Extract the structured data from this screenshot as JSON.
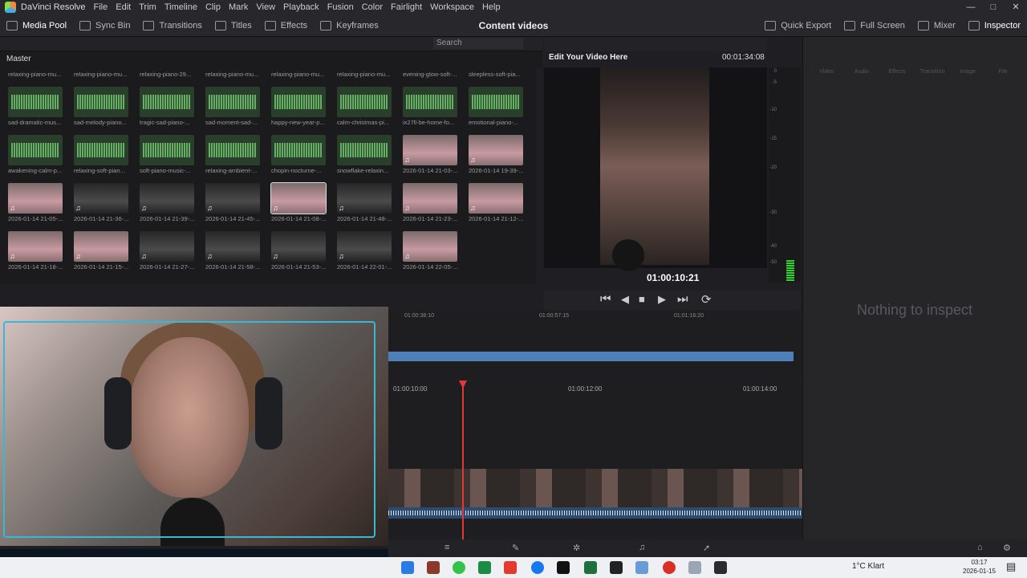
{
  "menubar": {
    "app_name": "DaVinci Resolve",
    "items": [
      "File",
      "Edit",
      "Trim",
      "Timeline",
      "Clip",
      "Mark",
      "View",
      "Playback",
      "Fusion",
      "Color",
      "Fairlight",
      "Workspace",
      "Help"
    ]
  },
  "toolbar": {
    "media_pool": "Media Pool",
    "sync_bin": "Sync Bin",
    "transitions": "Transitions",
    "titles": "Titles",
    "effects": "Effects",
    "keyframes": "Keyframes",
    "project_title": "Content videos",
    "quick_export": "Quick Export",
    "full_screen": "Full Screen",
    "mixer": "Mixer",
    "inspector": "Inspector"
  },
  "media_pool": {
    "search_placeholder": "Search",
    "bin_name": "Master",
    "top_labels": [
      "relaxing-piano-mu...",
      "relaxing-piano-mu...",
      "relaxing-piano-29...",
      "relaxing-piano-mu...",
      "relaxing-piano-mu...",
      "relaxing-piano-mu...",
      "evening-glow-soft-...",
      "sleepless-soft-pia..."
    ],
    "rows": [
      [
        {
          "label": "sad-dramatic-mus...",
          "kind": "audio"
        },
        {
          "label": "sad-melody-piano...",
          "kind": "audio"
        },
        {
          "label": "tragic-sad-piano-...",
          "kind": "audio"
        },
        {
          "label": "sad-moment-sad-...",
          "kind": "audio"
        },
        {
          "label": "happy-new-year-p...",
          "kind": "audio"
        },
        {
          "label": "calm-christmas-pi...",
          "kind": "audio"
        },
        {
          "label": "ix27ll-be-home-fo...",
          "kind": "audio"
        },
        {
          "label": "emotional-piano-...",
          "kind": "audio"
        }
      ],
      [
        {
          "label": "awakening-calm-p...",
          "kind": "audio"
        },
        {
          "label": "relaxing-soft-pian...",
          "kind": "audio"
        },
        {
          "label": "soft-piano-music-...",
          "kind": "audio"
        },
        {
          "label": "relaxing-ambient-...",
          "kind": "audio"
        },
        {
          "label": "chopin-nocturne-...",
          "kind": "audio"
        },
        {
          "label": "snowflake-relaxin...",
          "kind": "audio"
        },
        {
          "label": "2026-01-14 21-03-...",
          "kind": "video"
        },
        {
          "label": "2026-01-14 19-39-...",
          "kind": "video"
        }
      ],
      [
        {
          "label": "2026-01-14 21-05-...",
          "kind": "video"
        },
        {
          "label": "2026-01-14 21-36-...",
          "kind": "dark"
        },
        {
          "label": "2026-01-14 21-39-...",
          "kind": "dark"
        },
        {
          "label": "2026-01-14 21-45-...",
          "kind": "dark"
        },
        {
          "label": "2026-01-14 21-08-...",
          "kind": "video",
          "selected": true
        },
        {
          "label": "2026-01-14 21-48-...",
          "kind": "dark"
        },
        {
          "label": "2026-01-14 21-23-...",
          "kind": "video"
        },
        {
          "label": "2026-01-14 21-12-...",
          "kind": "video"
        }
      ],
      [
        {
          "label": "2026-01-14 21-18-...",
          "kind": "video"
        },
        {
          "label": "2026-01-14 21-15-...",
          "kind": "video"
        },
        {
          "label": "2026-01-14 21-27-...",
          "kind": "dark"
        },
        {
          "label": "2026-01-14 21-58-...",
          "kind": "dark"
        },
        {
          "label": "2026-01-14 21-53-...",
          "kind": "dark"
        },
        {
          "label": "2026-01-14 22-01-...",
          "kind": "dark"
        },
        {
          "label": "2026-01-14 22-05-...",
          "kind": "video"
        }
      ]
    ]
  },
  "viewer": {
    "title": "Edit Your Video Here",
    "duration": "00:01:34:08",
    "timecode": "01:00:10:21"
  },
  "meter": {
    "labels": [
      "0",
      "-5",
      "-10",
      "-15",
      "-20",
      "-30",
      "-40",
      "-50"
    ]
  },
  "inspector": {
    "tabs": [
      "Video",
      "Audio",
      "Effects",
      "Transition",
      "Image",
      "File"
    ],
    "empty_text": "Nothing to inspect"
  },
  "timeline": {
    "upper_ruler": [
      "01:00:38:10",
      "01:00:57:15",
      "01:01:16:20"
    ],
    "lower_ruler": [
      "01:00:10:00",
      "01:00:12:00",
      "01:00:14:00"
    ]
  },
  "taskbar": {
    "weather": "1°C  Klart",
    "time": "03:17",
    "date": "2026-01-15"
  }
}
